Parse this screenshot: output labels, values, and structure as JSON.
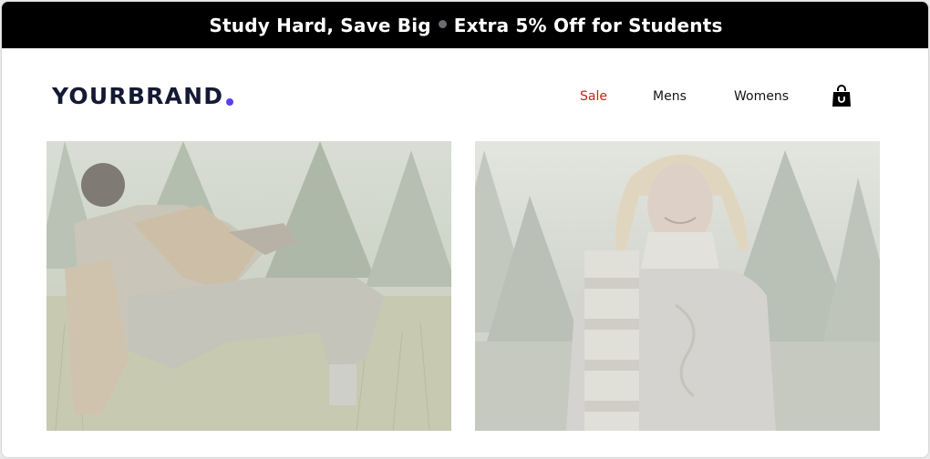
{
  "promo": {
    "part1": "Study Hard, Save Big",
    "part2": "Extra 5% Off for Students"
  },
  "header": {
    "logo_text": "YOURBRAND",
    "logo_dot_color": "#5b3ff0"
  },
  "nav": {
    "items": [
      {
        "label": "Sale",
        "color": "#c9201b"
      },
      {
        "label": "Mens",
        "color": "#141414"
      },
      {
        "label": "Womens",
        "color": "#141414"
      }
    ],
    "cart_icon": "shopping-bag-icon"
  },
  "hero": {
    "left_image": "man-outdoors-photo",
    "right_image": "woman-sweater-photo"
  }
}
